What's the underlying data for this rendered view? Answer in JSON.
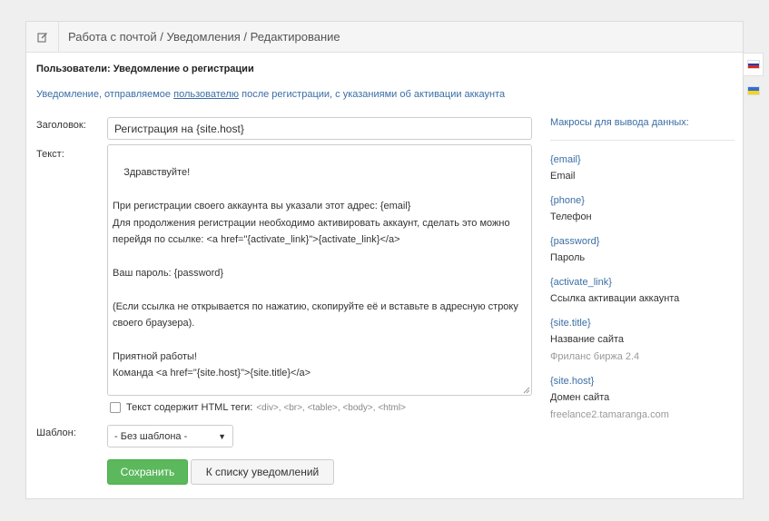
{
  "header": {
    "title": "Работа с почтой / Уведомления / Редактирование",
    "icon": "edit-icon"
  },
  "form": {
    "title": "Пользователи: Уведомление о регистрации",
    "desc_before": "Уведомление, отправляемое ",
    "desc_link": "пользователю",
    "desc_after": " после регистрации, с указаниями об активации аккаунта",
    "subject_label": "Заголовок:",
    "subject_value": "Регистрация на {site.host}",
    "text_label": "Текст:",
    "text_value": "Здравствуйте!\n\nПри регистрации своего аккаунта вы указали этот адрес: {email}\nДля продолжения регистрации необходимо активировать аккаунт, сделать это можно перейдя по ссылке: <a href=\"{activate_link}\">{activate_link}</a>\n\nВаш пароль: {password}\n\n(Если ссылка не открывается по нажатию, скопируйте её и вставьте в адресную строку своего браузера).\n\nПриятной работы!\nКоманда <a href=\"{site.host}\">{site.title}</a>\n\n*** Это письмо сформировано автоматически, отвечать на него не нужно ***",
    "html_checkbox_label": "Текст содержит HTML теги:",
    "html_tags": "<div>, <br>, <table>, <body>, <html>",
    "html_checked": false,
    "template_label": "Шаблон:",
    "template_selected": "- Без шаблона -",
    "save_button": "Сохранить",
    "list_button": "К списку уведомлений"
  },
  "macros": {
    "title": "Макросы для вывода данных:",
    "items": [
      {
        "key": "{email}",
        "desc": "Email",
        "example": ""
      },
      {
        "key": "{phone}",
        "desc": "Телефон",
        "example": ""
      },
      {
        "key": "{password}",
        "desc": "Пароль",
        "example": ""
      },
      {
        "key": "{activate_link}",
        "desc": "Ссылка активации аккаунта",
        "example": ""
      },
      {
        "key": "{site.title}",
        "desc": "Название сайта",
        "example": "Фриланс биржа 2.4"
      },
      {
        "key": "{site.host}",
        "desc": "Домен сайта",
        "example": "freelance2.tamaranga.com"
      }
    ]
  },
  "languages": [
    {
      "code": "ru",
      "flag_colors": [
        "#ffffff",
        "#1c3fbf",
        "#d52b1e"
      ],
      "active": true
    },
    {
      "code": "uk",
      "flag_colors": [
        "#2f6fd8",
        "#f7d417"
      ],
      "active": false
    }
  ],
  "colors": {
    "accent": "#3a6ea5",
    "save_green": "#5cb85c"
  }
}
